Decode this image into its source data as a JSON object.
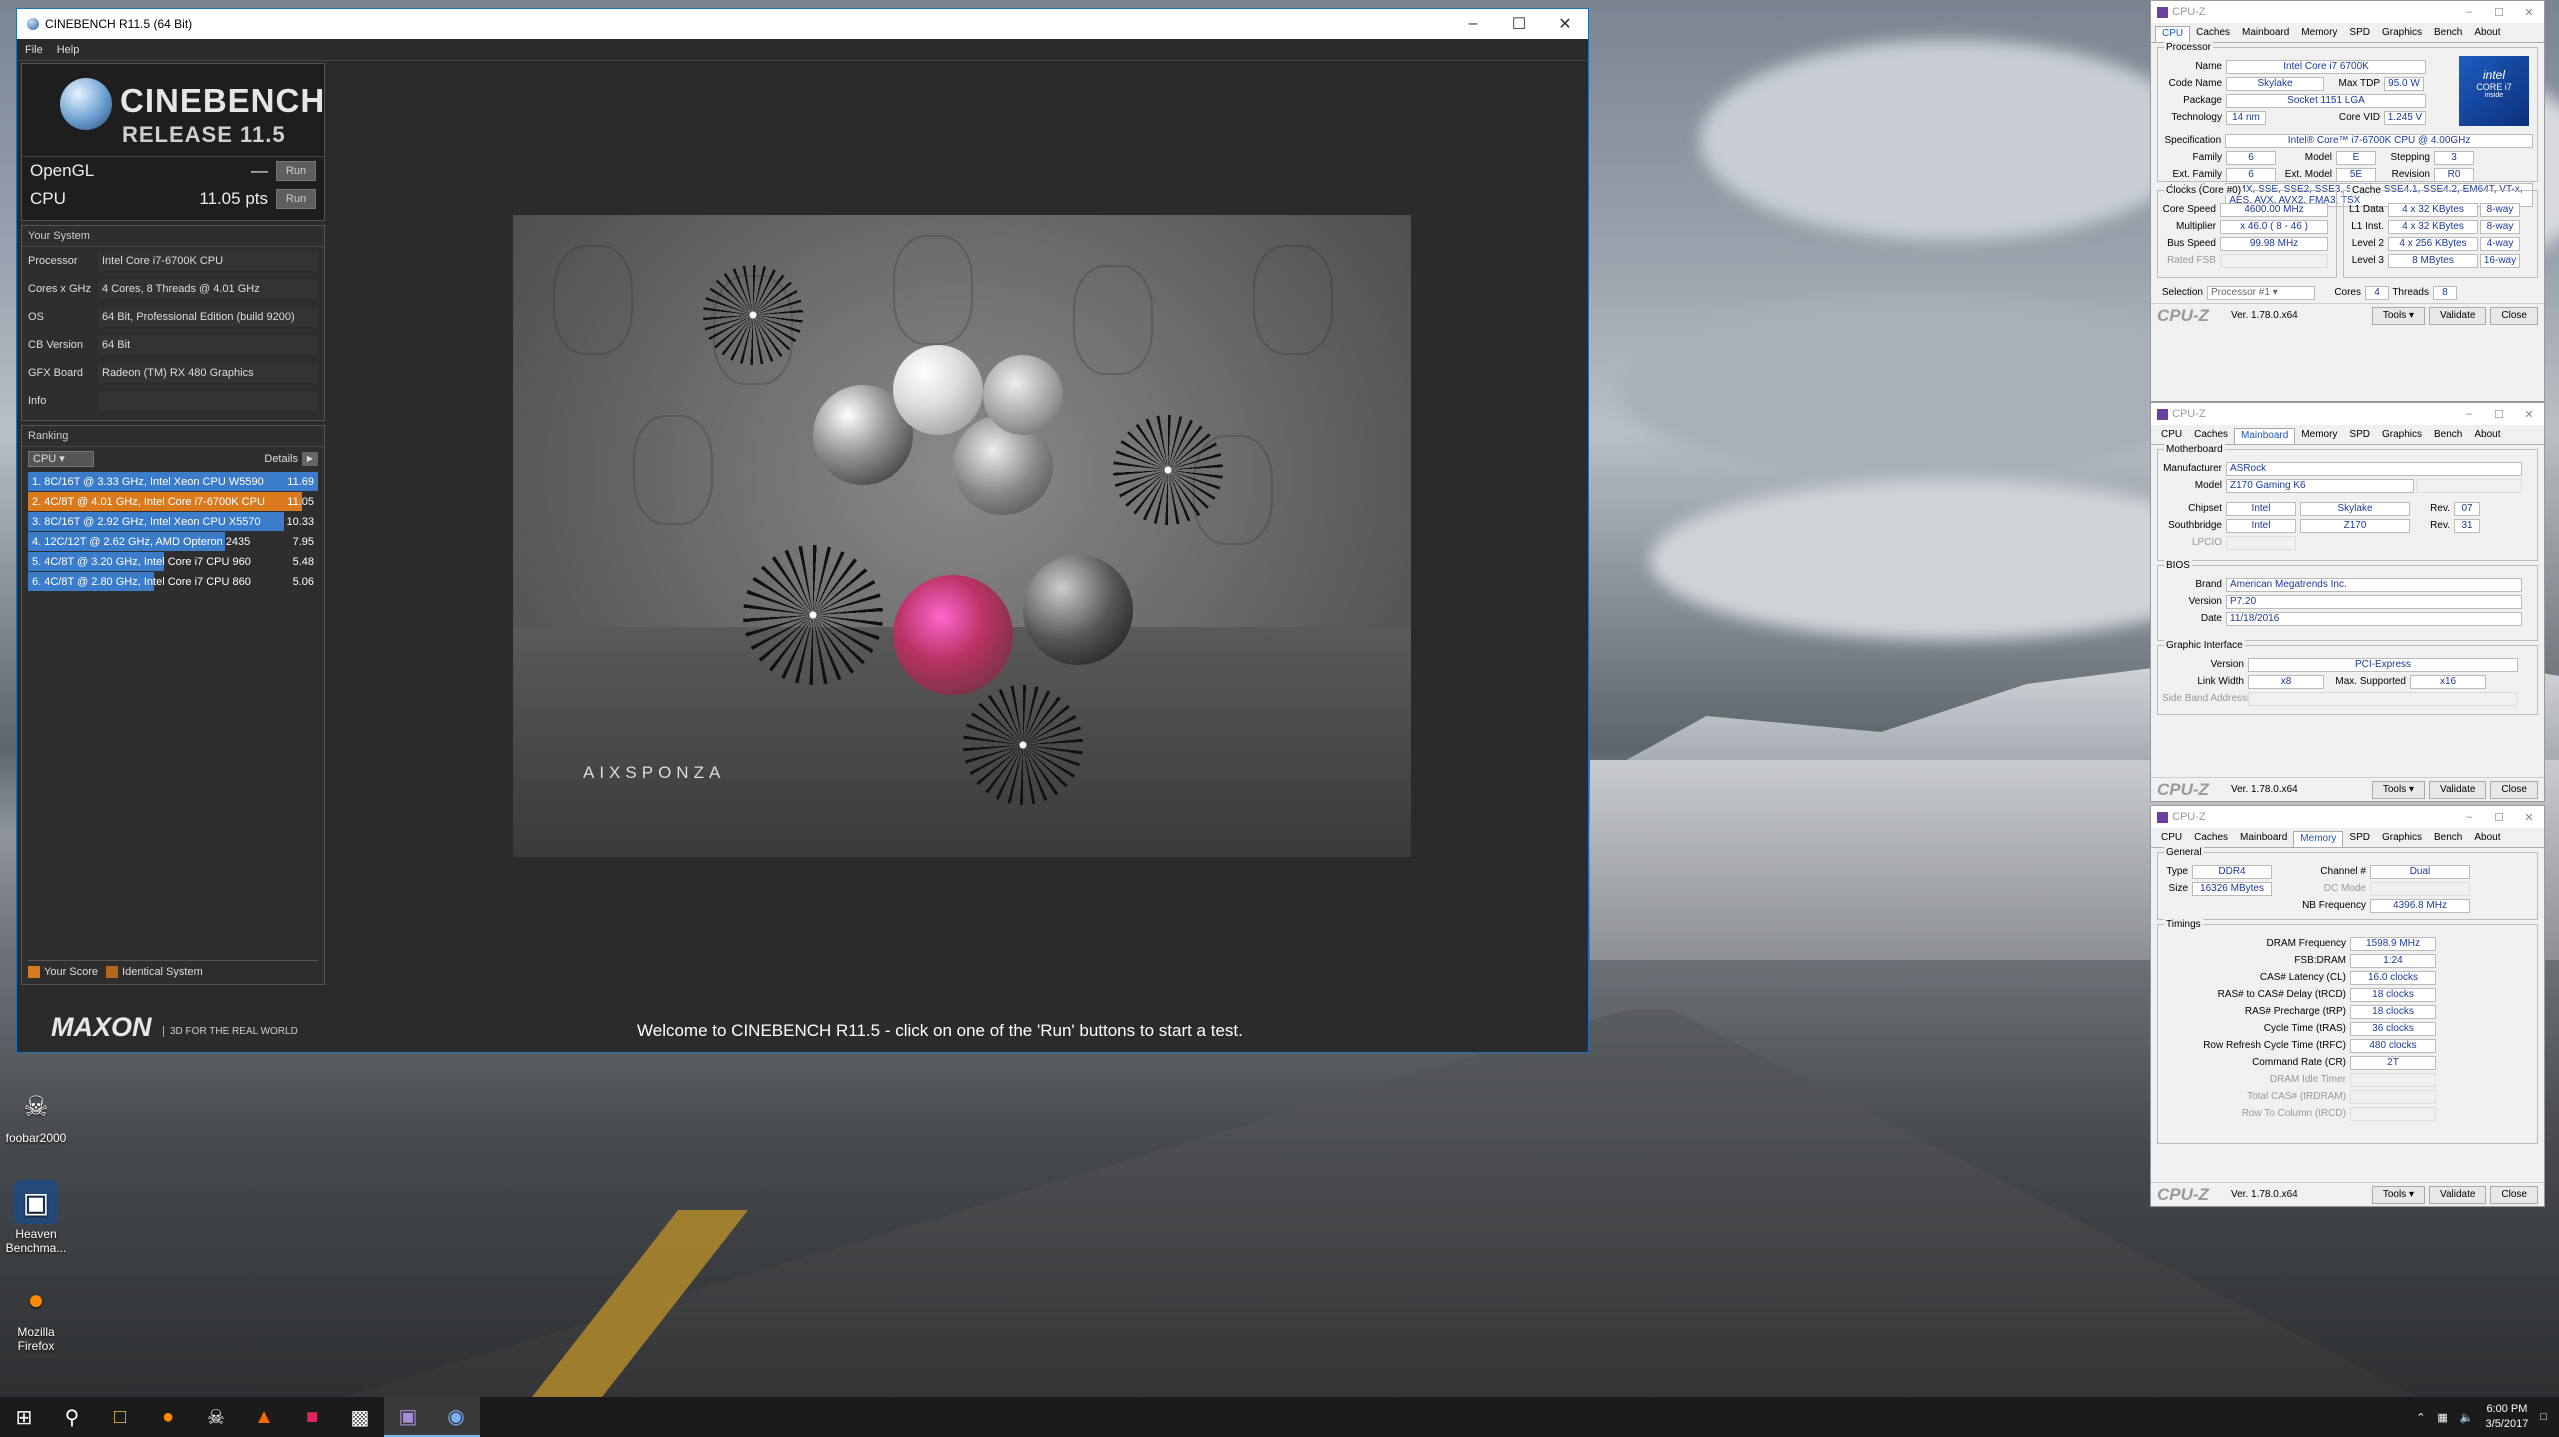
{
  "desktop": {
    "icons": [
      {
        "name": "foobar-icon",
        "label": "foobar2000",
        "glyph": "☠"
      },
      {
        "name": "heaven-icon",
        "label": "Heaven Benchma...",
        "glyph": "▣"
      },
      {
        "name": "firefox-icon",
        "label": "Mozilla Firefox",
        "glyph": "●"
      }
    ]
  },
  "cinebench": {
    "title": "CINEBENCH R11.5 (64 Bit)",
    "menu": [
      "File",
      "Help"
    ],
    "logo_line1": "CINEBENCH",
    "logo_line2": "RELEASE 11.5",
    "opengl": {
      "label": "OpenGL",
      "value": "—",
      "run": "Run"
    },
    "cpu": {
      "label": "CPU",
      "value": "11.05 pts",
      "run": "Run"
    },
    "your_system": "Your System",
    "system": [
      {
        "k": "Processor",
        "v": "Intel Core i7-6700K CPU"
      },
      {
        "k": "Cores x GHz",
        "v": "4 Cores, 8 Threads @ 4.01 GHz"
      },
      {
        "k": "OS",
        "v": "64 Bit, Professional Edition (build 9200)"
      },
      {
        "k": "CB Version",
        "v": "64 Bit"
      },
      {
        "k": "GFX Board",
        "v": "Radeon (TM) RX 480 Graphics"
      },
      {
        "k": "Info",
        "v": ""
      }
    ],
    "ranking": "Ranking",
    "ranking_select": "CPU",
    "details": "Details",
    "ranks": [
      {
        "t": "1. 8C/16T @ 3.33 GHz, Intel Xeon CPU W5590",
        "s": "11.69",
        "pct": 1.0,
        "color": "#3a7cc9"
      },
      {
        "t": "2. 4C/8T @ 4.01 GHz, Intel Core i7-6700K CPU",
        "s": "11.05",
        "pct": 0.945,
        "color": "#d97a1e"
      },
      {
        "t": "3. 8C/16T @ 2.92 GHz, Intel Xeon CPU X5570",
        "s": "10.33",
        "pct": 0.884,
        "color": "#3a7cc9"
      },
      {
        "t": "4. 12C/12T @ 2.62 GHz, AMD Opteron 2435",
        "s": "7.95",
        "pct": 0.68,
        "color": "#3a7cc9"
      },
      {
        "t": "5. 4C/8T @ 3.20 GHz, Intel Core i7 CPU 960",
        "s": "5.48",
        "pct": 0.469,
        "color": "#3a7cc9"
      },
      {
        "t": "6. 4C/8T @ 2.80 GHz, Intel Core i7 CPU 860",
        "s": "5.06",
        "pct": 0.433,
        "color": "#3a7cc9"
      }
    ],
    "legend_your": "Your Score",
    "legend_identical": "Identical System",
    "brand": "MAXON",
    "tagline": "3D FOR THE REAL WORLD",
    "render_brand": "AIXSPONZA",
    "welcome": "Welcome to CINEBENCH R11.5 - click on one of the 'Run' buttons to start a test."
  },
  "cpuz": {
    "title": "CPU-Z",
    "tabs": [
      "CPU",
      "Caches",
      "Mainboard",
      "Memory",
      "SPD",
      "Graphics",
      "Bench",
      "About"
    ],
    "version": "Ver. 1.78.0.x64",
    "tools": "Tools",
    "validate": "Validate",
    "close": "Close",
    "brand": "CPU-Z",
    "cpu": {
      "processor": "Processor",
      "name": "Intel Core i7 6700K",
      "codename": "Skylake",
      "maxtdp": "95.0 W",
      "package": "Socket 1151 LGA",
      "technology": "14 nm",
      "corevid": "1.245 V",
      "spec": "Intel® Core™ i7-6700K CPU @ 4.00GHz",
      "family": "6",
      "model": "E",
      "stepping": "3",
      "extfamily": "6",
      "extmodel": "5E",
      "revision": "R0",
      "instructions": "MMX, SSE, SSE2, SSE3, SSSE3, SSE4.1, SSE4.2, EM64T, VT-x, AES, AVX, AVX2, FMA3, TSX",
      "clocks_title": "Clocks (Core #0)",
      "corespeed": "4600.00 MHz",
      "multiplier": "x 46.0 ( 8 - 46 )",
      "busspeed": "99.98 MHz",
      "ratedfsb": "",
      "cache_title": "Cache",
      "l1d": "4 x 32 KBytes",
      "l1dw": "8-way",
      "l1i": "4 x 32 KBytes",
      "l1iw": "8-way",
      "l2": "4 x 256 KBytes",
      "l2w": "4-way",
      "l3": "8 MBytes",
      "l3w": "16-way",
      "selection": "Processor #1",
      "cores": "4",
      "threads": "8",
      "intel_line1": "intel",
      "intel_line2": "CORE i7",
      "intel_line3": "inside"
    },
    "mb": {
      "title": "Motherboard",
      "manufacturer": "ASRock",
      "model": "Z170 Gaming K6",
      "chipset": "Intel",
      "chipset2": "Skylake",
      "chiprev": "07",
      "south": "Intel",
      "south2": "Z170",
      "southrev": "31",
      "lpcio": "",
      "bios_title": "BIOS",
      "brand": "American Megatrends Inc.",
      "version": "P7.20",
      "date": "11/18/2016",
      "gi_title": "Graphic Interface",
      "giversion": "PCI-Express",
      "linkwidth": "x8",
      "maxsupported": "x16",
      "sideband": ""
    },
    "mem": {
      "general": "General",
      "type": "DDR4",
      "channel": "Dual",
      "size": "16326 MBytes",
      "dcmode": "",
      "nbfreq": "4396.8 MHz",
      "timings": "Timings",
      "dram": "1598.9 MHz",
      "fsbdram": "1:24",
      "cas": "16.0 clocks",
      "trcd": "18 clocks",
      "trp": "18 clocks",
      "tras": "36 clocks",
      "trfc": "480 clocks",
      "cr": "2T",
      "idle": "",
      "trdram": "",
      "trcd2": ""
    }
  },
  "taskbar": {
    "time": "6:00 PM",
    "date": "3/5/2017"
  }
}
